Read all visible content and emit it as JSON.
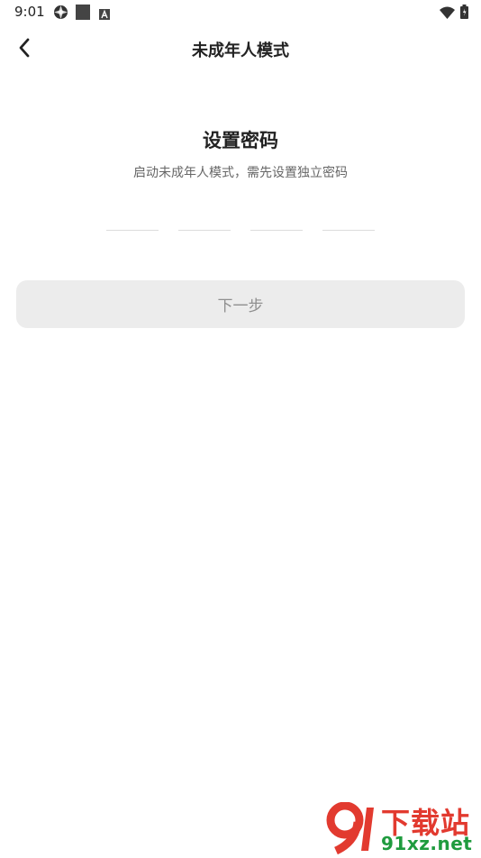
{
  "status_bar": {
    "time": "9:01",
    "left_icons": [
      "aperture-icon",
      "square-icon",
      "font-icon"
    ],
    "right_icons": [
      "wifi-icon",
      "battery-icon"
    ]
  },
  "nav": {
    "back_icon": "chevron-left-icon",
    "title": "未成年人模式"
  },
  "content": {
    "heading": "设置密码",
    "subtitle": "启动未成年人模式，需先设置独立密码",
    "pin_slots": [
      "",
      "",
      "",
      ""
    ],
    "next_button": "下一步"
  },
  "watermark": {
    "logo_text": "91",
    "title": "下载站",
    "url": "91xz.net"
  },
  "colors": {
    "background": "#ffffff",
    "button_bg": "#ececec",
    "button_text": "#8f8f8f",
    "pin_underline": "#dcdcdc",
    "watermark_red": "#e23a2f",
    "watermark_green": "#1f9b3e"
  }
}
